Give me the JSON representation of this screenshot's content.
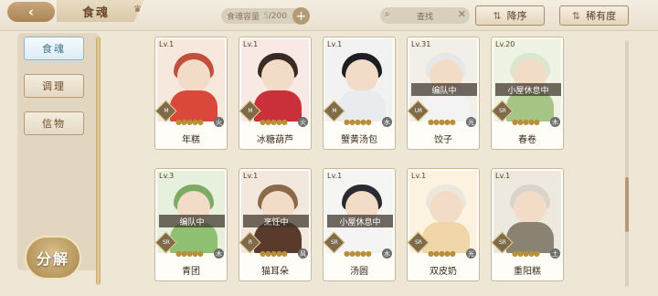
{
  "header": {
    "back_icon": "back-arrow-icon",
    "title": "食魂",
    "capacity_label": "食魂容量",
    "capacity_current": "5",
    "capacity_max": "/200",
    "search_placeholder": "查找",
    "sort_label": "降序",
    "rarity_label": "稀有度"
  },
  "sidebar": {
    "tabs": [
      {
        "label": "食魂",
        "active": true
      },
      {
        "label": "调理",
        "active": false
      },
      {
        "label": "信物",
        "active": false
      }
    ],
    "decompose_label": "分解"
  },
  "cards": [
    {
      "level": "Lv.1",
      "name": "年糕",
      "rarity": "M",
      "status": "",
      "hair": "#c0503a",
      "body": "#d9483a",
      "bg": "#f6e8dd",
      "elem": "火"
    },
    {
      "level": "Lv.1",
      "name": "冰糖葫芦",
      "rarity": "M",
      "status": "",
      "hair": "#3a2a22",
      "body": "#c9303a",
      "bg": "#f8e9e4",
      "elem": "火"
    },
    {
      "level": "Lv.1",
      "name": "蟹黄汤包",
      "rarity": "M",
      "status": "",
      "hair": "#1e1e22",
      "body": "#e9ecef",
      "bg": "#f2f2f2",
      "elem": "水"
    },
    {
      "level": "Lv.31",
      "name": "饺子",
      "rarity": "UR",
      "status": "编队中",
      "hair": "#e7e7e9",
      "body": "#f3f3f3",
      "bg": "#f2efe9",
      "elem": "光"
    },
    {
      "level": "Lv.20",
      "name": "春卷",
      "rarity": "SR",
      "status": "小屋休息中",
      "hair": "#dbe6cd",
      "body": "#a6c483",
      "bg": "#eef3e3",
      "elem": "木"
    },
    {
      "level": "Lv.3",
      "name": "青团",
      "rarity": "SR",
      "status": "编队中",
      "hair": "#7dab63",
      "body": "#8fbf70",
      "bg": "#e6f0dc",
      "elem": "木"
    },
    {
      "level": "Lv.1",
      "name": "猫耳朵",
      "rarity": "R",
      "status": "烹饪中",
      "hair": "#8a6a4a",
      "body": "#5a3a2a",
      "bg": "#f2e8de",
      "elem": "风"
    },
    {
      "level": "Lv.1",
      "name": "汤圆",
      "rarity": "SR",
      "status": "小屋休息中",
      "hair": "#2a2a33",
      "body": "#f4f4f4",
      "bg": "#f5f5f3",
      "elem": "水"
    },
    {
      "level": "Lv.1",
      "name": "双皮奶",
      "rarity": "SR",
      "status": "",
      "hair": "#ece7dc",
      "body": "#f0d6a8",
      "bg": "#fbf3e0",
      "elem": "光"
    },
    {
      "level": "Lv.1",
      "name": "重阳糕",
      "rarity": "SR",
      "status": "",
      "hair": "#d9d3c9",
      "body": "#8a8273",
      "bg": "#eee9df",
      "elem": "土"
    }
  ],
  "colors": {
    "accent": "#a98356",
    "active_tab": "#3c6f88",
    "text": "#3a2a1a"
  }
}
